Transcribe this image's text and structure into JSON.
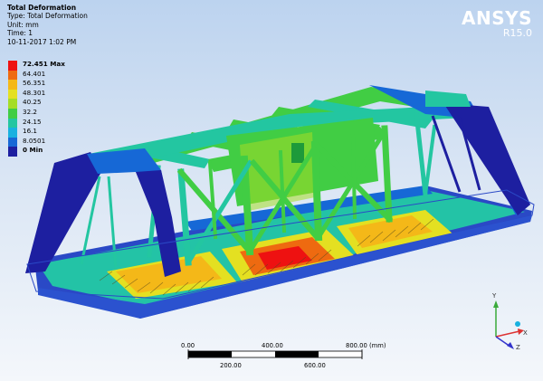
{
  "info": {
    "title": "Total Deformation",
    "type": "Type: Total Deformation",
    "unit": "Unit: mm",
    "time": "Time: 1",
    "date": "10-11-2017 1:02 PM"
  },
  "brand": {
    "name": "ANSYS",
    "version": "R15.0"
  },
  "legend": [
    {
      "label": "72.451 Max",
      "color": "#ee1111",
      "bold": true
    },
    {
      "label": "64.401",
      "color": "#ee6a10",
      "bold": false
    },
    {
      "label": "56.351",
      "color": "#f4b818",
      "bold": false
    },
    {
      "label": "48.301",
      "color": "#e4e021",
      "bold": false
    },
    {
      "label": "40.25",
      "color": "#a5dd26",
      "bold": false
    },
    {
      "label": "32.2",
      "color": "#41cd44",
      "bold": false
    },
    {
      "label": "24.15",
      "color": "#23c6a1",
      "bold": false
    },
    {
      "label": "16.1",
      "color": "#18b1e0",
      "bold": false
    },
    {
      "label": "8.0501",
      "color": "#1668d6",
      "bold": false
    },
    {
      "label": "0 Min",
      "color": "#1d1fa0",
      "bold": true
    }
  ],
  "scalebar": {
    "top_ticks": [
      "0.00",
      "400.00",
      "800.00 (mm)"
    ],
    "bottom_ticks": [
      "200.00",
      "600.00"
    ]
  },
  "triad": {
    "y": "Y",
    "x": "X",
    "z": "Z"
  }
}
